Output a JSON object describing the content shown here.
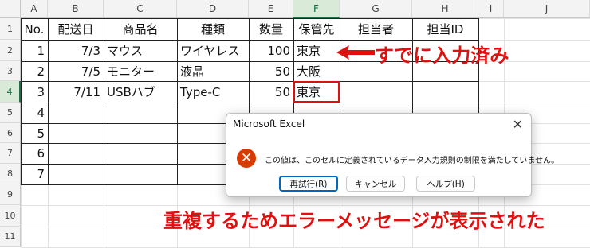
{
  "columns": [
    "A",
    "B",
    "C",
    "D",
    "E",
    "F",
    "G",
    "H",
    "I",
    "J"
  ],
  "rows": [
    "1",
    "2",
    "3",
    "4",
    "5",
    "6",
    "7",
    "8",
    "9",
    "10",
    "11"
  ],
  "header_row": [
    "No.",
    "配送日",
    "商品名",
    "種類",
    "数量",
    "保管先",
    "担当者",
    "担当ID"
  ],
  "data_rows": [
    [
      "1",
      "7/3",
      "マウス",
      "ワイヤレス",
      "100",
      "東京"
    ],
    [
      "2",
      "7/5",
      "モニター",
      "液晶",
      "50",
      "大阪"
    ],
    [
      "3",
      "7/11",
      "USBハブ",
      "Type-C",
      "50",
      "東京"
    ],
    [
      "4"
    ],
    [
      "5"
    ],
    [
      "6"
    ],
    [
      "7"
    ]
  ],
  "annotations": {
    "already_entered": "すでに入力済み",
    "error_note": "重複するためエラーメッセージが表示された"
  },
  "dialog": {
    "title": "Microsoft Excel",
    "close_glyph": "✕",
    "icon_glyph": "✕",
    "message": "この値は、このセルに定義されているデータ入力規則の制限を満たしていません。",
    "buttons": {
      "retry": "再試行(R)",
      "cancel": "キャンセル",
      "help": "ヘルプ(H)"
    }
  },
  "colors": {
    "annotation": "#e01010",
    "error_icon": "#d83b01",
    "selected_header": "#1e7145"
  }
}
